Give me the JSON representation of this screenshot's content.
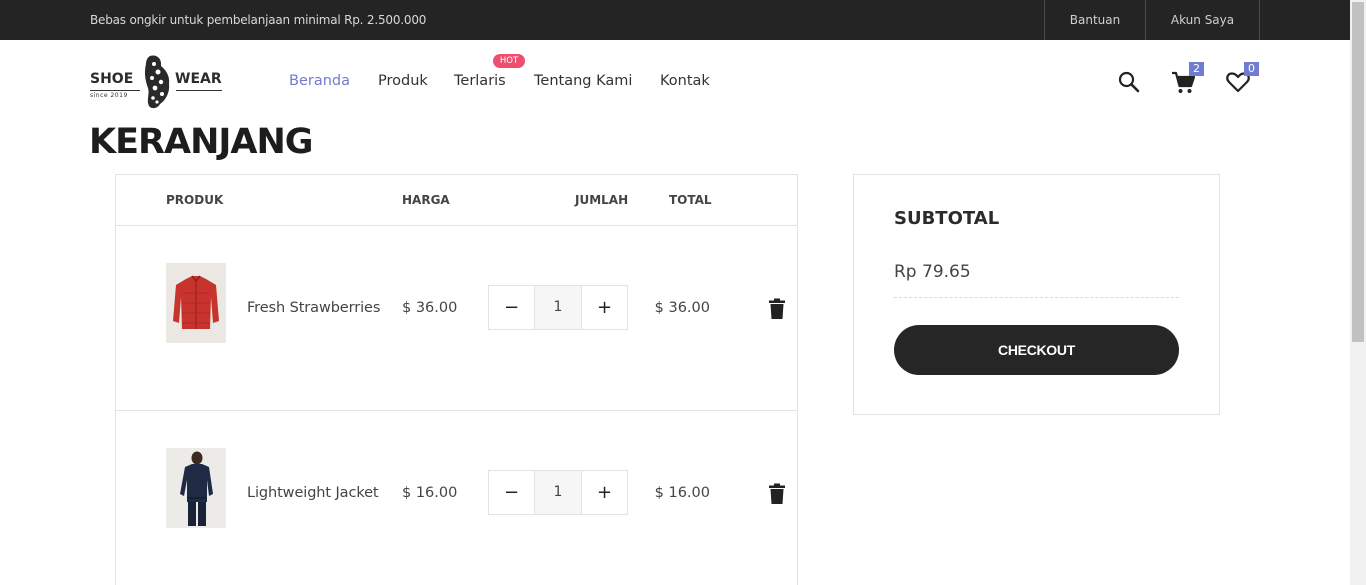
{
  "topbar": {
    "promo": "Bebas ongkir untuk pembelanjaan minimal Rp. 2.500.000",
    "help": "Bantuan",
    "account": "Akun Saya"
  },
  "logo": {
    "word_left": "SHOE",
    "word_right": "WEAR",
    "since": "since 2019"
  },
  "nav": {
    "items": [
      "Beranda",
      "Produk",
      "Terlaris",
      "Tentang Kami",
      "Kontak"
    ],
    "active": "Beranda",
    "hot_badge": "HOT"
  },
  "header_icons": {
    "search": "search-icon",
    "cart": "cart-icon",
    "cart_count": "2",
    "wishlist": "heart-icon",
    "wishlist_count": "0"
  },
  "page": {
    "title": "KERANJANG"
  },
  "cart": {
    "columns": [
      "PRODUK",
      "HARGA",
      "JUMLAH",
      "TOTAL"
    ],
    "items": [
      {
        "name": "Fresh Strawberries",
        "price": "$ 36.00",
        "qty": "1",
        "total": "$ 36.00",
        "image": "red-jacket"
      },
      {
        "name": "Lightweight Jacket",
        "price": "$ 16.00",
        "qty": "1",
        "total": "$ 16.00",
        "image": "navy-jacket"
      }
    ],
    "minus": "−",
    "plus": "+"
  },
  "summary": {
    "title": "SUBTOTAL",
    "amount": "Rp 79.65",
    "checkout": "CHECKOUT"
  },
  "colors": {
    "topbar": "#242424",
    "accent": "#6f7ccf",
    "hot": "#ee4f6e",
    "button": "#262626"
  }
}
